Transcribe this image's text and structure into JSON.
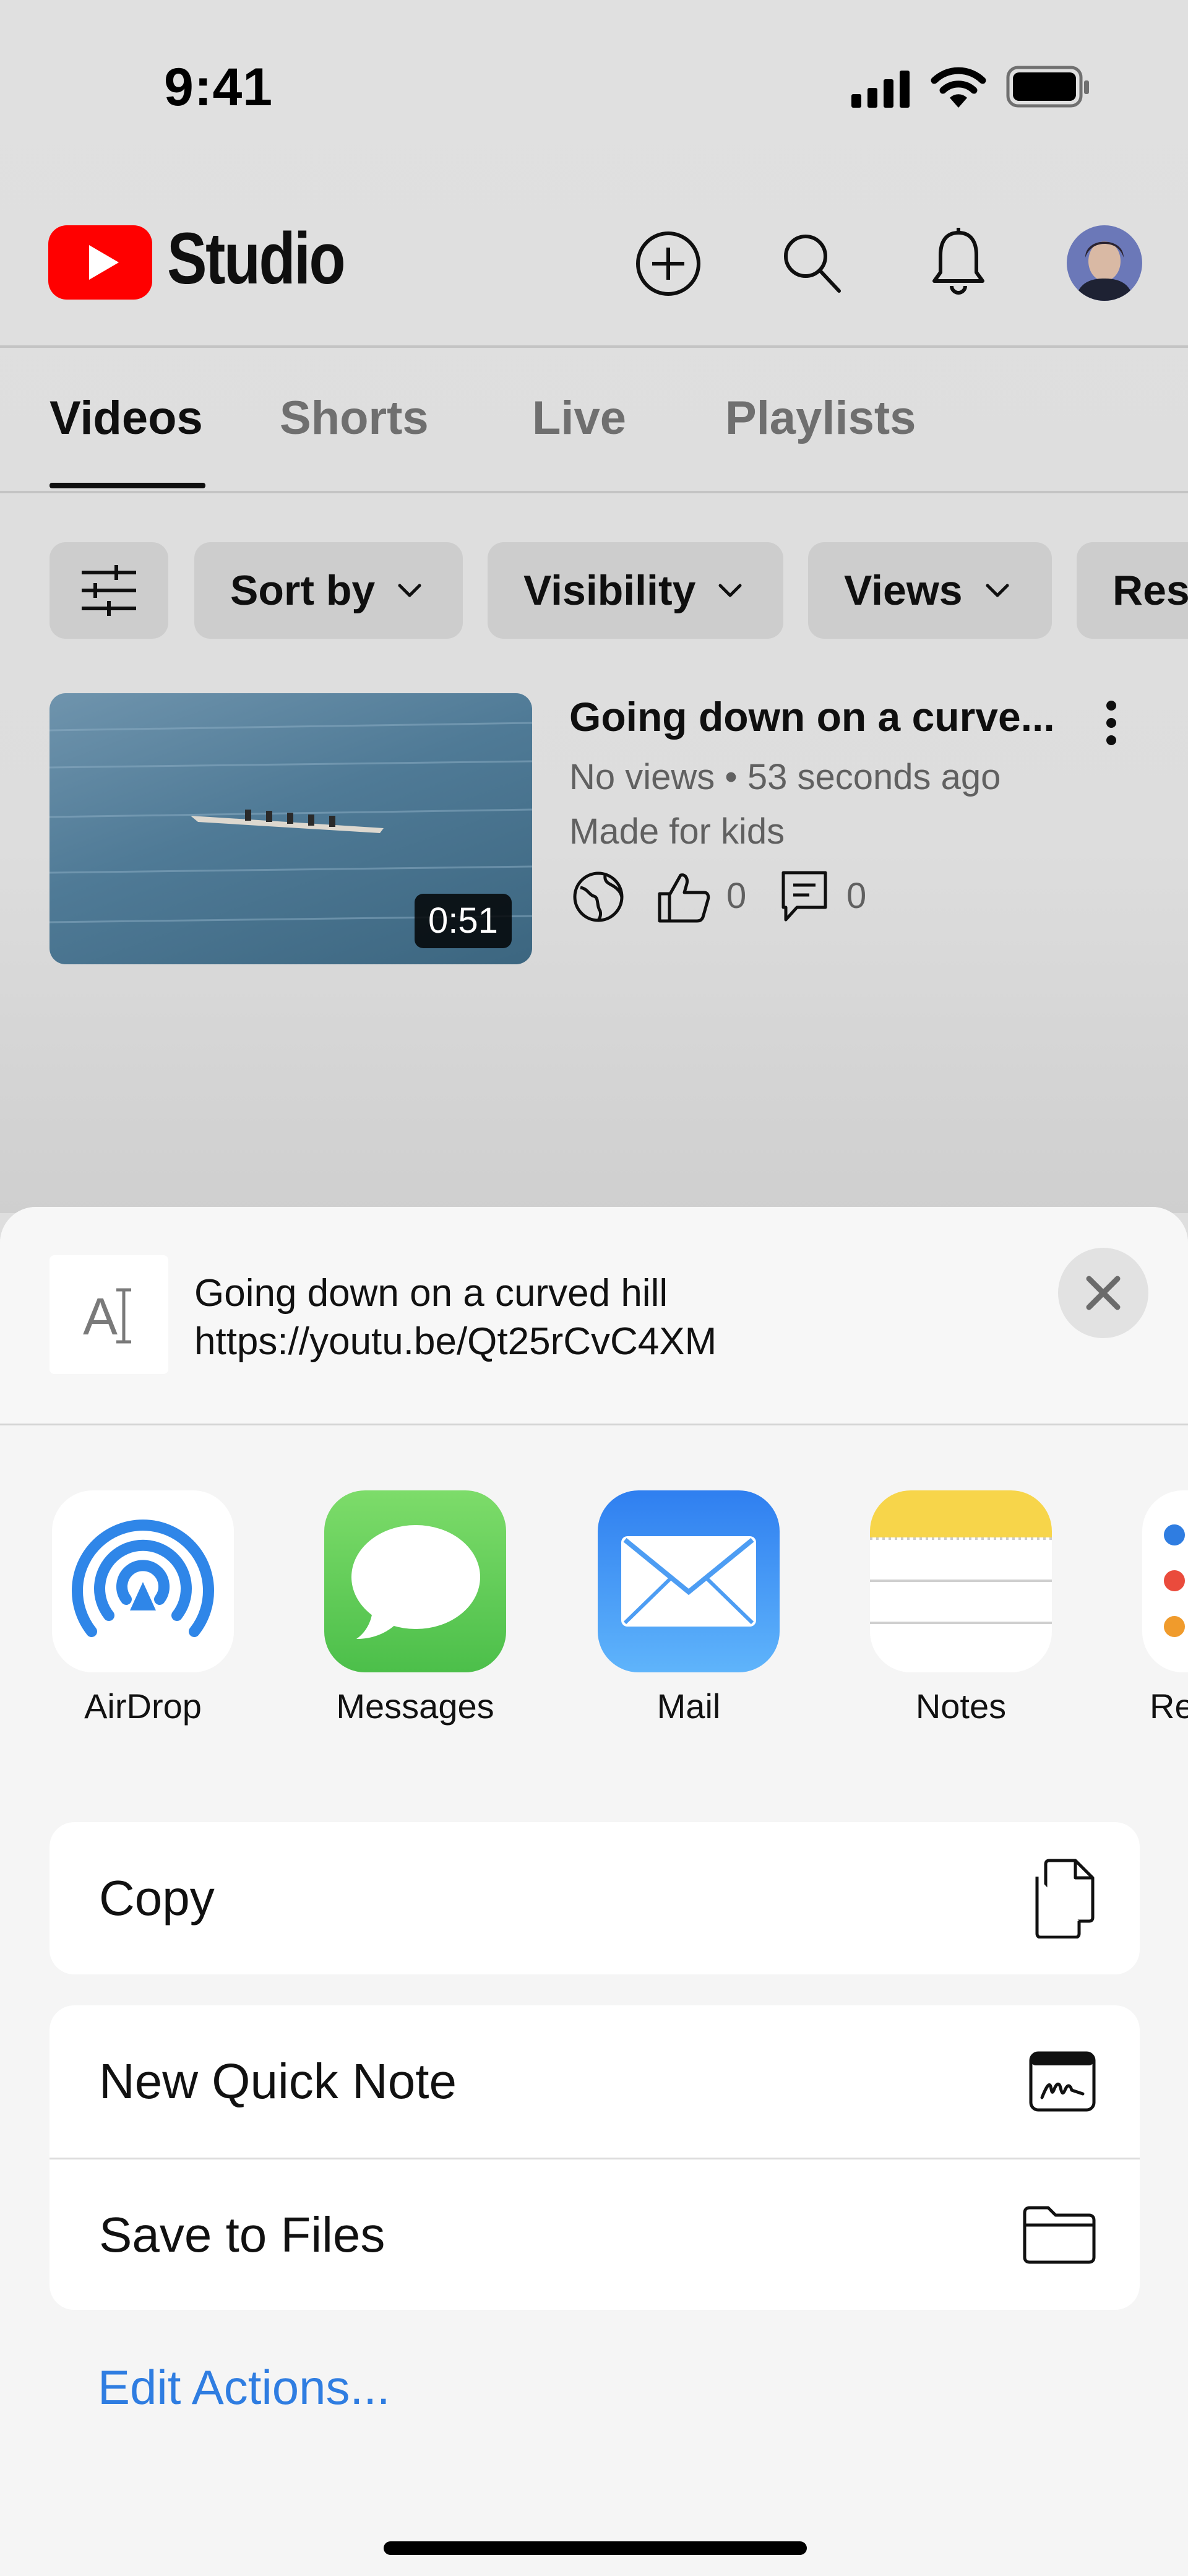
{
  "status_bar": {
    "time": "9:41"
  },
  "header": {
    "app_name": "Studio"
  },
  "tabs": [
    {
      "label": "Videos",
      "active": true
    },
    {
      "label": "Shorts"
    },
    {
      "label": "Live"
    },
    {
      "label": "Playlists"
    }
  ],
  "filters": {
    "chips": [
      {
        "label": "Sort by"
      },
      {
        "label": "Visibility"
      },
      {
        "label": "Views"
      },
      {
        "label": "Res"
      }
    ]
  },
  "video": {
    "title": "Going down on a curve...",
    "duration": "0:51",
    "meta": "No views • 53 seconds ago",
    "audience": "Made for kids",
    "likes": "0",
    "comments": "0"
  },
  "share_sheet": {
    "title": "Going down on a curved hill",
    "url": "https://youtu.be/Qt25rCvC4XM",
    "apps": [
      {
        "label": "AirDrop",
        "icon": "airdrop-icon"
      },
      {
        "label": "Messages",
        "icon": "messages-icon"
      },
      {
        "label": "Mail",
        "icon": "mail-icon"
      },
      {
        "label": "Notes",
        "icon": "notes-icon"
      },
      {
        "label": "Re",
        "icon": "reminders-icon"
      }
    ],
    "actions": {
      "copy": "Copy",
      "quick_note": "New Quick Note",
      "save_files": "Save to Files"
    },
    "edit_actions": "Edit Actions..."
  },
  "colors": {
    "youtube_red": "#ff0000",
    "link_blue": "#2f7de1",
    "messages_green": "#5bc55a",
    "mail_blue": "#3d8ef0",
    "notes_yellow": "#f7d54a"
  }
}
